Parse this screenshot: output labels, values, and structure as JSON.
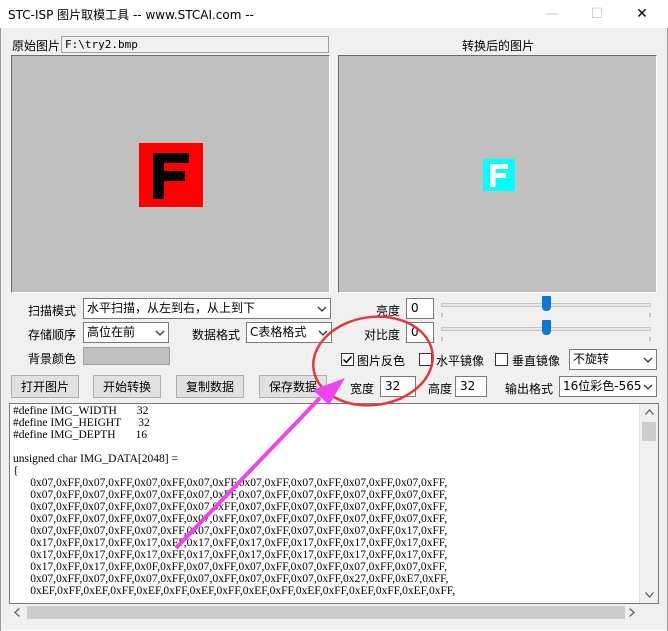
{
  "window": {
    "title": "STC-ISP 图片取模工具 -- www.STCAI.com --",
    "minimize": "—",
    "maximize": "☐",
    "close": "✕"
  },
  "labels": {
    "source_image": "原始图片",
    "converted_image": "转换后的图片",
    "scan_mode": "扫描模式",
    "storage_order": "存储顺序",
    "data_format": "数据格式",
    "bg_color": "背景颜色",
    "brightness": "亮度",
    "contrast": "对比度",
    "width": "宽度",
    "height": "高度",
    "output_format": "输出格式"
  },
  "source_path": "F:\\try2.bmp",
  "preview": {
    "glyph": "F",
    "source_bg": "#ff0000",
    "source_fg": "#000000",
    "converted_bg": "#00ffff",
    "converted_fg": "#ffffff"
  },
  "combos": {
    "scan_mode": "水平扫描，从左到右，从上到下",
    "storage_order": "高位在前",
    "data_format": "C表格格式",
    "rotation": "不旋转",
    "output_format": "16位彩色-565"
  },
  "values": {
    "brightness": "0",
    "contrast": "0",
    "width": "32",
    "height": "32",
    "brightness_level": 0.5,
    "contrast_level": 0.5
  },
  "checkboxes": {
    "invert": {
      "label": "图片反色",
      "checked": true
    },
    "hmirror": {
      "label": "水平镜像",
      "checked": false
    },
    "vmirror": {
      "label": "垂直镜像",
      "checked": false
    }
  },
  "buttons": {
    "open": "打开图片",
    "convert": "开始转换",
    "copy": "复制数据",
    "save": "保存数据"
  },
  "code_lines": [
    "#define IMG_WIDTH       32",
    "#define IMG_HEIGHT      32",
    "#define IMG_DEPTH       16",
    "",
    "unsigned char IMG_DATA[2048] =",
    "{",
    "      0x07,0xFF,0x07,0xFF,0x07,0xFF,0x07,0xFF,0x07,0xFF,0x07,0xFF,0x07,0xFF,0x07,0xFF,",
    "      0x07,0xFF,0x07,0xFF,0x07,0xFF,0x07,0xFF,0x07,0xFF,0x07,0xFF,0x07,0xFF,0x07,0xFF,",
    "      0x07,0xFF,0x07,0xFF,0x07,0xFF,0x07,0xFF,0x07,0xFF,0x07,0xFF,0x07,0xFF,0x07,0xFF,",
    "      0x07,0xFF,0x07,0xFF,0x07,0xFF,0x07,0xFF,0x07,0xFF,0x07,0xFF,0x07,0xFF,0x07,0xFF,",
    "      0x07,0xFF,0x07,0xFF,0x07,0xFF,0x07,0xFF,0x07,0xFF,0x07,0xFF,0x07,0xFF,0x17,0xFF,",
    "      0x17,0xFF,0x17,0xFF,0x17,0xFF,0x17,0xFF,0x17,0xFF,0x17,0xFF,0x17,0xFF,0x17,0xFF,",
    "      0x17,0xFF,0x17,0xFF,0x17,0xFF,0x17,0xFF,0x17,0xFF,0x17,0xFF,0x17,0xFF,0x17,0xFF,",
    "      0x17,0xFF,0x17,0xFF,0x0F,0xFF,0x07,0xFF,0x07,0xFF,0x07,0xFF,0x07,0xFF,0x07,0xFF,",
    "      0x07,0xFF,0x07,0xFF,0x07,0xFF,0x07,0xFF,0x07,0xFF,0x07,0xFF,0x27,0xFF,0xE7,0xFF,",
    "      0xEF,0xFF,0xEF,0xFF,0xEF,0xFF,0xEF,0xFF,0xEF,0xFF,0xEF,0xFF,0xEF,0xFF,0xEF,0xFF,"
  ],
  "annotation": {
    "highlight_color": "#e23a3a",
    "arrow_color": "#ee44ee"
  }
}
